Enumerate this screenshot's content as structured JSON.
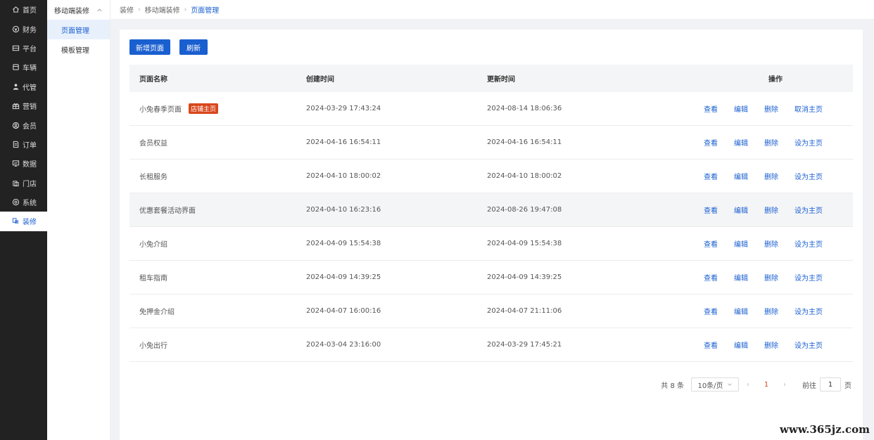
{
  "nav": {
    "items": [
      {
        "label": "首页",
        "icon": "home-icon"
      },
      {
        "label": "财务",
        "icon": "finance-icon"
      },
      {
        "label": "平台",
        "icon": "platform-icon"
      },
      {
        "label": "车辆",
        "icon": "vehicle-icon"
      },
      {
        "label": "代管",
        "icon": "agent-icon"
      },
      {
        "label": "营销",
        "icon": "gift-icon"
      },
      {
        "label": "会员",
        "icon": "member-icon"
      },
      {
        "label": "订单",
        "icon": "order-icon"
      },
      {
        "label": "数据",
        "icon": "monitor-icon"
      },
      {
        "label": "门店",
        "icon": "store-icon"
      },
      {
        "label": "系统",
        "icon": "settings-icon"
      },
      {
        "label": "装修",
        "icon": "decor-icon"
      }
    ],
    "active_index": 11
  },
  "submenu": {
    "group_label": "移动端装修",
    "items": [
      {
        "label": "页面管理",
        "active": true
      },
      {
        "label": "模板管理",
        "active": false
      }
    ]
  },
  "breadcrumb": [
    "装修",
    "移动端装修",
    "页面管理"
  ],
  "toolbar": {
    "add_label": "新增页面",
    "refresh_label": "刷新"
  },
  "table": {
    "headers": {
      "name": "页面名称",
      "created": "创建时间",
      "updated": "更新时间",
      "ops": "操作"
    },
    "ops": {
      "view": "查看",
      "edit": "编辑",
      "delete": "删除"
    },
    "rows": [
      {
        "name": "小兔春季页面",
        "badge": "店铺主页",
        "created": "2024-03-29 17:43:24",
        "updated": "2024-08-14 18:06:36",
        "home_action": "取消主页"
      },
      {
        "name": "会员权益",
        "badge": "",
        "created": "2024-04-16 16:54:11",
        "updated": "2024-04-16 16:54:11",
        "home_action": "设为主页"
      },
      {
        "name": "长租服务",
        "badge": "",
        "created": "2024-04-10 18:00:02",
        "updated": "2024-04-10 18:00:02",
        "home_action": "设为主页"
      },
      {
        "name": "优惠套餐活动界面",
        "badge": "",
        "created": "2024-04-10 16:23:16",
        "updated": "2024-08-26 19:47:08",
        "home_action": "设为主页"
      },
      {
        "name": "小兔介绍",
        "badge": "",
        "created": "2024-04-09 15:54:38",
        "updated": "2024-04-09 15:54:38",
        "home_action": "设为主页"
      },
      {
        "name": "租车指南",
        "badge": "",
        "created": "2024-04-09 14:39:25",
        "updated": "2024-04-09 14:39:25",
        "home_action": "设为主页"
      },
      {
        "name": "免押金介绍",
        "badge": "",
        "created": "2024-04-07 16:00:16",
        "updated": "2024-04-07 21:11:06",
        "home_action": "设为主页"
      },
      {
        "name": "小兔出行",
        "badge": "",
        "created": "2024-03-04 23:16:00",
        "updated": "2024-03-29 17:45:21",
        "home_action": "设为主页"
      }
    ],
    "highlight_row": 3
  },
  "pagination": {
    "total": "共 8 条",
    "page_size": "10条/页",
    "current_page": "1",
    "jump_prefix": "前往",
    "jump_value": "1",
    "jump_suffix": "页"
  },
  "watermark": "www.365jz.com",
  "colors": {
    "primary": "#1a5fd0",
    "badge": "#d9471c",
    "sidebar": "#222222"
  }
}
